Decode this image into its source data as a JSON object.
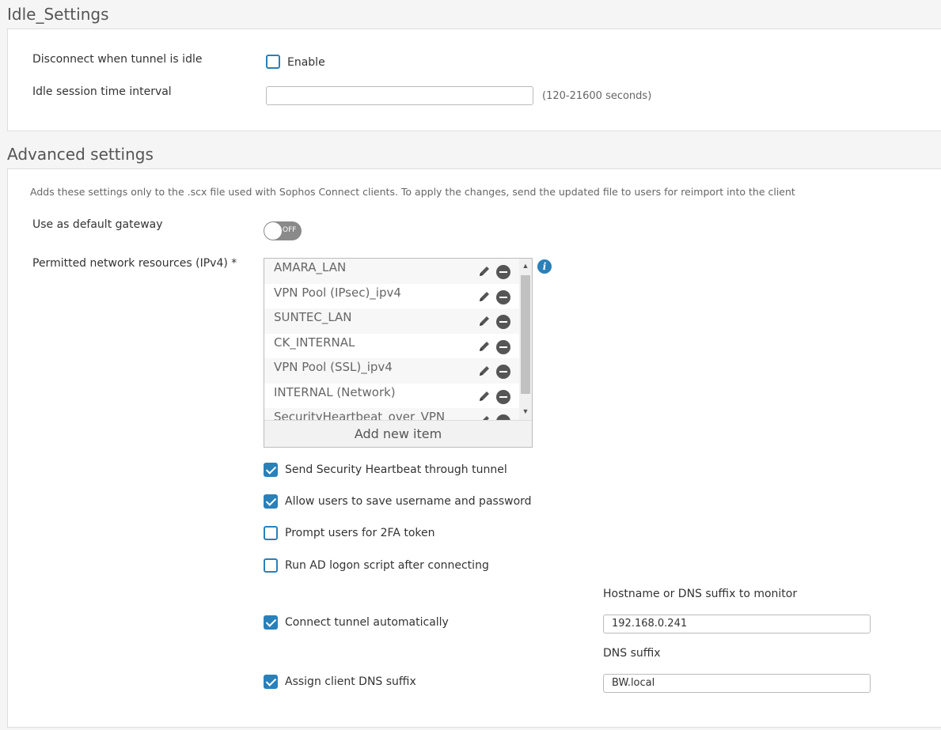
{
  "idle": {
    "title": "Idle_Settings",
    "disconnect_label": "Disconnect when tunnel is idle",
    "enable_label": "Enable",
    "enable_checked": false,
    "interval_label": "Idle session time interval",
    "interval_value": "",
    "interval_hint": "(120-21600 seconds)"
  },
  "advanced": {
    "title": "Advanced settings",
    "note": "Adds these settings only to the .scx file used with Sophos Connect clients. To apply the changes, send the updated file to users for reimport into the client",
    "default_gateway_label": "Use as default gateway",
    "default_gateway_state": "OFF",
    "resources_label": "Permitted network resources (IPv4) *",
    "resources": [
      "AMARA_LAN",
      "VPN Pool (IPsec)_ipv4",
      "SUNTEC_LAN",
      "CK_INTERNAL",
      "VPN Pool (SSL)_ipv4",
      "INTERNAL (Network)",
      "SecurityHeartbeat_over_VPN"
    ],
    "add_item_label": "Add new item",
    "info_glyph": "i",
    "scroll_up": "▲",
    "scroll_down": "▼",
    "options": {
      "heartbeat": {
        "label": "Send Security Heartbeat through tunnel",
        "checked": true
      },
      "save_credentials": {
        "label": "Allow users to save username and password",
        "checked": true
      },
      "twofa": {
        "label": "Prompt users for 2FA token",
        "checked": false
      },
      "ad_logon": {
        "label": "Run AD logon script after connecting",
        "checked": false
      },
      "auto_connect": {
        "label": "Connect tunnel automatically",
        "checked": true
      },
      "dns_suffix_assign": {
        "label": "Assign client DNS suffix",
        "checked": true
      }
    },
    "hostname_label": "Hostname or DNS suffix to monitor",
    "hostname_value": "192.168.0.241",
    "dns_suffix_label": "DNS suffix",
    "dns_suffix_value": "BW.local"
  },
  "colors": {
    "accent": "#2a80b9",
    "toggle_off": "#8a8a8a"
  }
}
